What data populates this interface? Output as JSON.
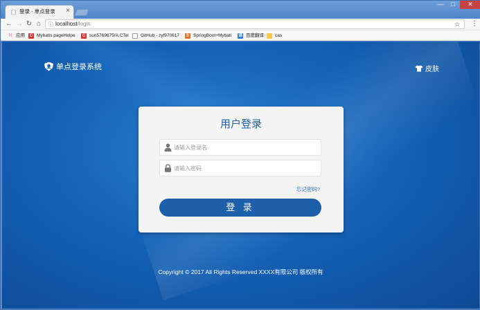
{
  "browser": {
    "tab_title": "登录 - 单点登录",
    "url_host": "localhost",
    "url_path": "/login",
    "bookmarks": [
      {
        "label": "应用",
        "icon": "apps-grid-icon"
      },
      {
        "label": "Mybatis pageHelpe",
        "icon": "c-red-icon"
      },
      {
        "label": "sun5769675/A.CTel",
        "icon": "c-red-icon"
      },
      {
        "label": "GitHub - zyf970617",
        "icon": "page-icon"
      },
      {
        "label": "SpringBoot+Mybati",
        "icon": "orange-icon"
      },
      {
        "label": "百度翻译",
        "icon": "translate-icon"
      },
      {
        "label": "cas",
        "icon": "folder-icon"
      }
    ],
    "colors": {
      "frame": "#5b8ccf",
      "close": "#c74343"
    }
  },
  "header": {
    "brand": "单点登录系统",
    "skin_label": "皮肤"
  },
  "login": {
    "title": "用户登录",
    "username_placeholder": "请输入登录名",
    "password_placeholder": "请输入密码",
    "forgot": "忘记密码?",
    "submit": "登 录"
  },
  "footer": {
    "copyright": "Copyright © 2017 All Rights Reserved XXXX有限公司 版权所有"
  },
  "colors": {
    "accent": "#1d5fa9",
    "background": "#1562b8",
    "card": "#f4f4f4"
  }
}
